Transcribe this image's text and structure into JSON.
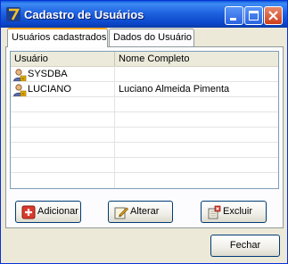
{
  "window": {
    "title": "Cadastro de Usuários",
    "controls": [
      "minimize-icon",
      "maximize-icon",
      "close-icon"
    ]
  },
  "tabs": [
    {
      "label": "Usuários cadastrados",
      "active": true
    },
    {
      "label": "Dados do Usuário",
      "active": false
    }
  ],
  "grid": {
    "columns": [
      "Usuário",
      "Nome Completo"
    ],
    "rows": [
      {
        "user": "SYSDBA",
        "full_name": "",
        "icon": "user-icon"
      },
      {
        "user": "LUCIANO",
        "full_name": "Luciano Almeida Pimenta",
        "icon": "user-icon"
      }
    ]
  },
  "actions": {
    "add_label": "Adicionar",
    "edit_label": "Alterar",
    "delete_label": "Excluir"
  },
  "footer": {
    "close_label": "Fechar"
  },
  "colors": {
    "titlebar": "#0a46c9",
    "dialog_bg": "#ece9d8",
    "button_border": "#003c74",
    "active_tab_accent": "#f5a623"
  }
}
